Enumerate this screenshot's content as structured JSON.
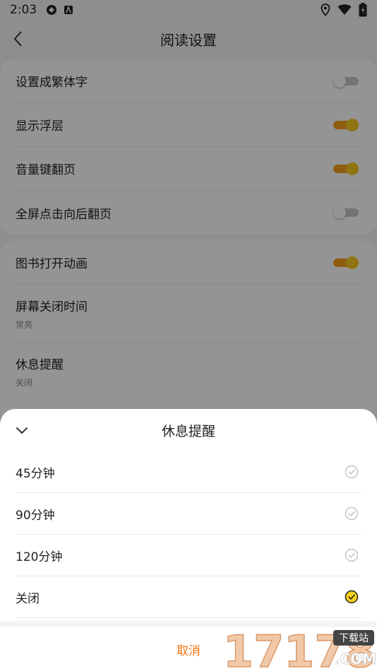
{
  "status_bar": {
    "time": "2:03"
  },
  "nav": {
    "title": "阅读设置"
  },
  "settings_group1": [
    {
      "label": "设置成繁体字",
      "toggle": "off"
    },
    {
      "label": "显示浮层",
      "toggle": "on"
    },
    {
      "label": "音量键翻页",
      "toggle": "on"
    },
    {
      "label": "全屏点击向后翻页",
      "toggle": "off"
    }
  ],
  "settings_group2": {
    "book_animation": {
      "label": "图书打开动画",
      "toggle": "on"
    },
    "screen_off": {
      "label": "屏幕关闭时间",
      "value": "常亮"
    },
    "rest_reminder": {
      "label": "休息提醒",
      "value": "关闭"
    }
  },
  "sheet": {
    "title": "休息提醒",
    "options": [
      {
        "label": "45分钟",
        "selected": false
      },
      {
        "label": "90分钟",
        "selected": false
      },
      {
        "label": "120分钟",
        "selected": false
      },
      {
        "label": "关闭",
        "selected": true
      }
    ],
    "cancel_label": "取消"
  },
  "watermark": {
    "number": "17178",
    "tag": "下载站",
    "domain": ".COM"
  },
  "colors": {
    "accent": "#f0751a",
    "toggle_track": "#f7a11a",
    "toggle_knob": "#f7c81f",
    "check_fill": "#f7d11e"
  }
}
